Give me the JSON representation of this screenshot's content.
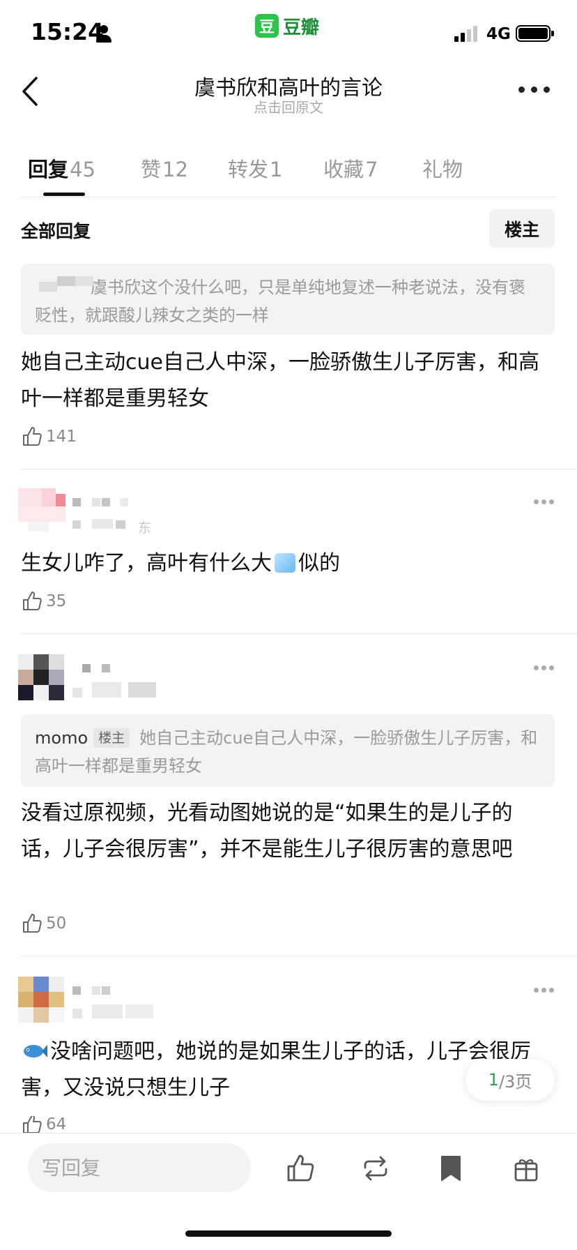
{
  "status_bar": {
    "time": "15:24",
    "network": "4G"
  },
  "app_badge": {
    "logo": "豆",
    "name": "豆瓣"
  },
  "header": {
    "title": "虞书欣和高叶的言论",
    "subtitle": "点击回原文"
  },
  "tabs": [
    {
      "label": "回复",
      "count": "45",
      "active": true
    },
    {
      "label": "赞",
      "count": "12"
    },
    {
      "label": "转发",
      "count": "1"
    },
    {
      "label": "收藏",
      "count": "7"
    },
    {
      "label": "礼物",
      "count": ""
    }
  ],
  "filter": {
    "label": "全部回复",
    "op_toggle": "楼主"
  },
  "comments": [
    {
      "quote": "虞书欣这个没什么吧，只是单纯地复述一种老说法，没有褒贬性，就跟酸儿辣女之类的一样",
      "text": "她自己主动cue自己人中深，一脸骄傲生儿子厉害，和高叶一样都是重男轻女",
      "likes": "141"
    },
    {
      "location_fragment": "东",
      "text_before": "生女儿咋了，高叶有什么大",
      "text_after": "似的",
      "likes": "35"
    },
    {
      "quote_name": "momo",
      "quote_badge": "楼主",
      "quote": "她自己主动cue自己人中深，一脸骄傲生儿子厉害，和高叶一样都是重男轻女",
      "text": "没看过原视频，光看动图她说的是“如果生的是儿子的话，儿子会很厉害”，并不是能生儿子很厉害的意思吧",
      "likes": "50"
    },
    {
      "text": "没啥问题吧，她说的是如果生儿子的话，儿子会很厉害，又没说只想生儿子",
      "likes": "64"
    }
  ],
  "pager": {
    "current": "1",
    "rest": "/3页"
  },
  "bottom_bar": {
    "reply_placeholder": "写回复"
  },
  "colors": {
    "brand_green": "#2dc44a",
    "pager_current": "#2aa44a"
  }
}
